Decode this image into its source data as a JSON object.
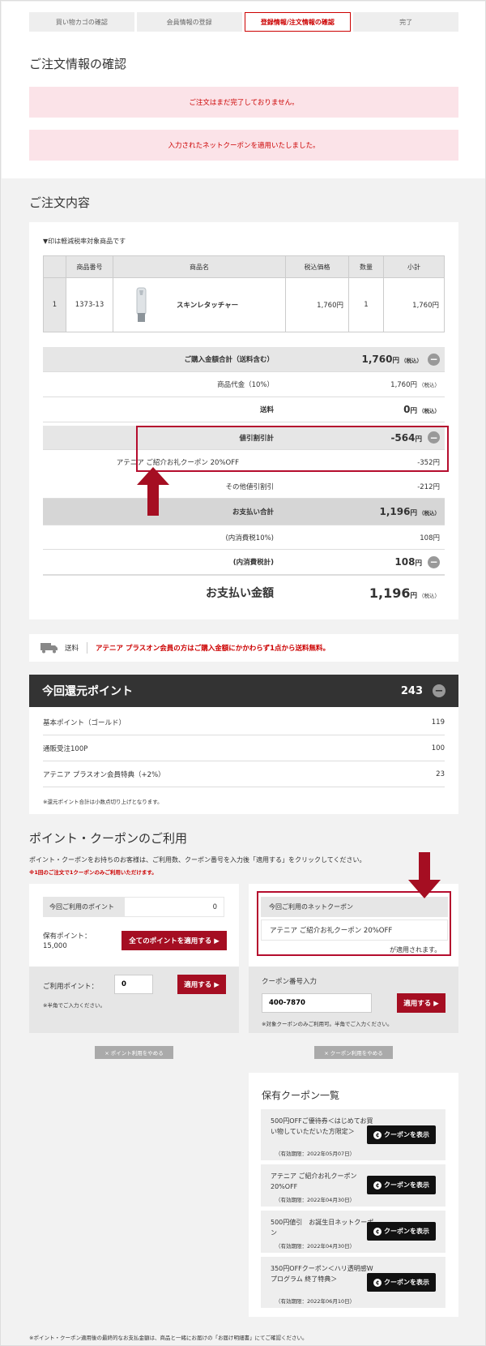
{
  "steps": [
    "買い物カゴの確認",
    "会員情報の登録",
    "登録情報/注文情報の確認",
    "完了"
  ],
  "page_title": "ご注文情報の確認",
  "alerts": [
    "ご注文はまだ完了しておりません。",
    "入力されたネットクーポンを適用いたしました。"
  ],
  "order": {
    "title": "ご注文内容",
    "note": "▼印は軽減税率対象商品です",
    "headers": [
      "",
      "商品番号",
      "商品名",
      "税込価格",
      "数量",
      "小計"
    ],
    "row": {
      "index": "1",
      "code": "1373-13",
      "name": "スキンレタッチャー",
      "price": "1,760円",
      "qty": "1",
      "subtotal": "1,760円"
    }
  },
  "summary": {
    "purchase_total_label": "ご購入金額合計（送料含む）",
    "purchase_total": "1,760",
    "yen": "円",
    "tax_in": "（税込）",
    "goods_label": "商品代金（10%）",
    "goods": "1,760円",
    "shipping_label": "送料",
    "shipping": "0",
    "discount_label": "値引割引計",
    "discount": "-564",
    "coupon_label": "アテニア ご紹介お礼クーポン 20%OFF",
    "coupon": "-352円",
    "other_label": "その他値引割引",
    "other": "-212円",
    "pay_total_label": "お支払い合計",
    "pay_total": "1,196",
    "tax10_label": "(内消費税10%)",
    "tax10": "108円",
    "tax_total_label": "(内消費税計)",
    "tax_total": "108",
    "amount_label": "お支払い金額",
    "amount": "1,196"
  },
  "shipping_bar": {
    "label": "送料",
    "text": "アテニア プラスオン会員の方はご購入金額にかかわらず1点から送料無料。"
  },
  "points": {
    "title": "今回還元ポイント",
    "total": "243",
    "rows": [
      {
        "label": "基本ポイント（ゴールド）",
        "value": "119"
      },
      {
        "label": "通販受注100P",
        "value": "100"
      },
      {
        "label": "アテニア プラスオン会員特典（+2%）",
        "value": "23"
      }
    ],
    "note": "※還元ポイント合計は小数点切り上げとなります。"
  },
  "use": {
    "title": "ポイント・クーポンのご利用",
    "desc": "ポイント・クーポンをお持ちのお客様は、ご利用数、クーポン番号を入力後「適用する」をクリックしてください。",
    "warn": "※1回のご注文で1クーポンのみご利用いただけます。",
    "current_point_label": "今回ご利用のポイント",
    "current_point": "0",
    "held_label": "保有ポイント：",
    "held": "15,000",
    "apply_all": "全てのポイントを適用する ▶",
    "use_point_label": "ご利用ポイント：",
    "use_point_value": "0",
    "apply": "適用する ▶",
    "half_note": "※半角でご入力ください。",
    "stop_point": "× ポイント利用をやめる",
    "current_coupon_label": "今回ご利用のネットクーポン",
    "current_coupon": "アテニア ご紹介お礼クーポン 20%OFF",
    "applied_text": "が適用されます。",
    "coupon_input_label": "クーポン番号入力",
    "coupon_input_value": "400-7870",
    "coupon_note": "※対象クーポンのみご利用可。半角でご入力ください。",
    "stop_coupon": "× クーポン利用をやめる"
  },
  "coupons": {
    "title": "保有クーポン一覧",
    "btn": "クーポンを表示",
    "items": [
      {
        "name": "500円OFFご優待券＜はじめてお買い物していただいた方限定＞",
        "date": "（有効期限：2022年05月07日）"
      },
      {
        "name": "アテニア ご紹介お礼クーポン 20%OFF",
        "date": "（有効期限：2022年04月30日）"
      },
      {
        "name": "500円値引　お誕生日ネットクーポン",
        "date": "（有効期限：2022年04月30日）"
      },
      {
        "name": "350円OFFクーポン＜ハリ透明感Wプログラム 終了特典＞",
        "date": "（有効期限：2022年06月10日）"
      }
    ]
  },
  "footer_note": "※ポイント・クーポン適用後の最終的なお支払金額は、商品と一緒にお届けの「お届け明細書」にてご確認ください。",
  "colors": {
    "accent": "#a50e22",
    "alert_bg": "#fbe3e8",
    "highlight": "#b50d2e"
  }
}
